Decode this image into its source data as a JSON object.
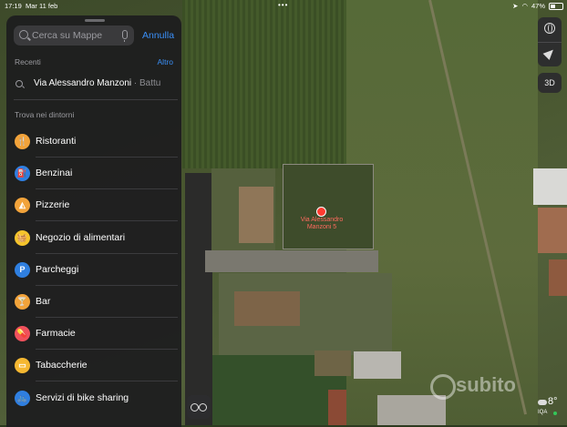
{
  "status_bar": {
    "time": "17:19",
    "date": "Mar 11 feb",
    "dots": "•••",
    "battery": "47%"
  },
  "search": {
    "placeholder": "Cerca su Mappe",
    "cancel_label": "Annulla"
  },
  "recents": {
    "title": "Recenti",
    "more_label": "Altro",
    "items": [
      {
        "title": "Via Alessandro Manzoni",
        "subtitle": " · Battu"
      }
    ]
  },
  "nearby": {
    "title": "Trova nei dintorni",
    "categories": [
      {
        "label": "Ristoranti",
        "icon": "fork-knife-icon",
        "glyph": "🍴",
        "color": "#f2a33a"
      },
      {
        "label": "Benzinai",
        "icon": "fuel-pump-icon",
        "glyph": "⛽",
        "color": "#2f7fe0"
      },
      {
        "label": "Pizzerie",
        "icon": "pizza-icon",
        "glyph": "◭",
        "color": "#f2a33a"
      },
      {
        "label": "Negozio di alimentari",
        "icon": "basket-icon",
        "glyph": "🧺",
        "color": "#f5c42c"
      },
      {
        "label": "Parcheggi",
        "icon": "parking-icon",
        "glyph": "P",
        "color": "#2f7fe0"
      },
      {
        "label": "Bar",
        "icon": "cocktail-icon",
        "glyph": "🍸",
        "color": "#f2a33a"
      },
      {
        "label": "Farmacie",
        "icon": "pharmacy-icon",
        "glyph": "💊",
        "color": "#f0515c"
      },
      {
        "label": "Tabaccherie",
        "icon": "tobacco-icon",
        "glyph": "▭",
        "color": "#f5b731"
      },
      {
        "label": "Servizi di bike sharing",
        "icon": "bike-icon",
        "glyph": "🚲",
        "color": "#2f7fe0"
      }
    ]
  },
  "map": {
    "pin_label_line1": "Via Alessandro",
    "pin_label_line2": "Manzoni 5",
    "controls": {
      "view_3d": "3D"
    }
  },
  "weather": {
    "temperature": "8°",
    "aqi": "IQA"
  },
  "watermark": "subito"
}
